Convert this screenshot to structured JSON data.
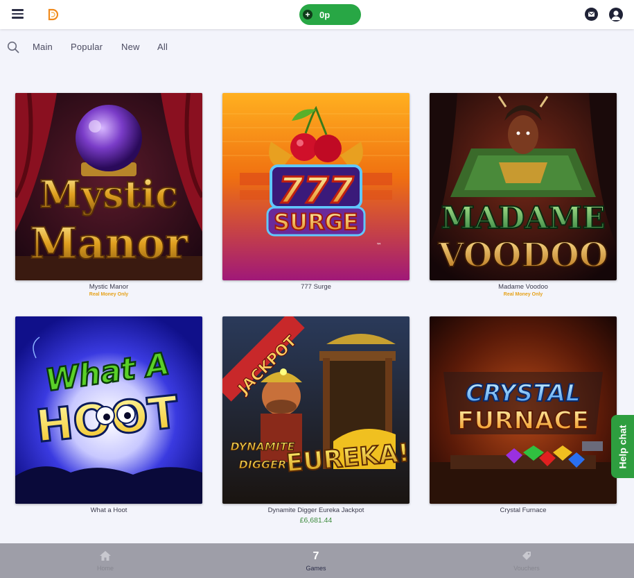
{
  "header": {
    "balance": "0p",
    "plus": "+"
  },
  "tabs": [
    "Main",
    "Popular",
    "New",
    "All"
  ],
  "games": [
    {
      "name": "Mystic Manor",
      "note": "Real Money Only",
      "art": [
        "Mystic",
        "Manor"
      ]
    },
    {
      "name": "777 Surge",
      "art": [
        "777",
        "SURGE"
      ]
    },
    {
      "name": "Madame Voodoo",
      "note": "Real Money Only",
      "art": [
        "MADAME",
        "VOODOO"
      ]
    },
    {
      "name": "What a Hoot",
      "art": [
        "What A",
        "HOOT"
      ]
    },
    {
      "name": "Dynamite Digger Eureka Jackpot",
      "price": "£6,681.44",
      "art": [
        "JACKPOT",
        "DYNAMITE",
        "DIGGER",
        "EUREKA!"
      ]
    },
    {
      "name": "Crystal Furnace",
      "art": [
        "CRYSTAL",
        "FURNACE"
      ]
    }
  ],
  "help_chat": "Help chat",
  "bottom_nav": [
    {
      "label": "Home",
      "icon": "home-icon"
    },
    {
      "label": "Games",
      "icon": "games-icon",
      "badge": "7"
    },
    {
      "label": "Vouchers",
      "icon": "voucher-icon"
    }
  ],
  "colors": {
    "accent_green": "#28a745",
    "real_money": "#e6a21a",
    "jackpot_price": "#3c8a3c",
    "nav_bar": "#9e9ea8"
  }
}
